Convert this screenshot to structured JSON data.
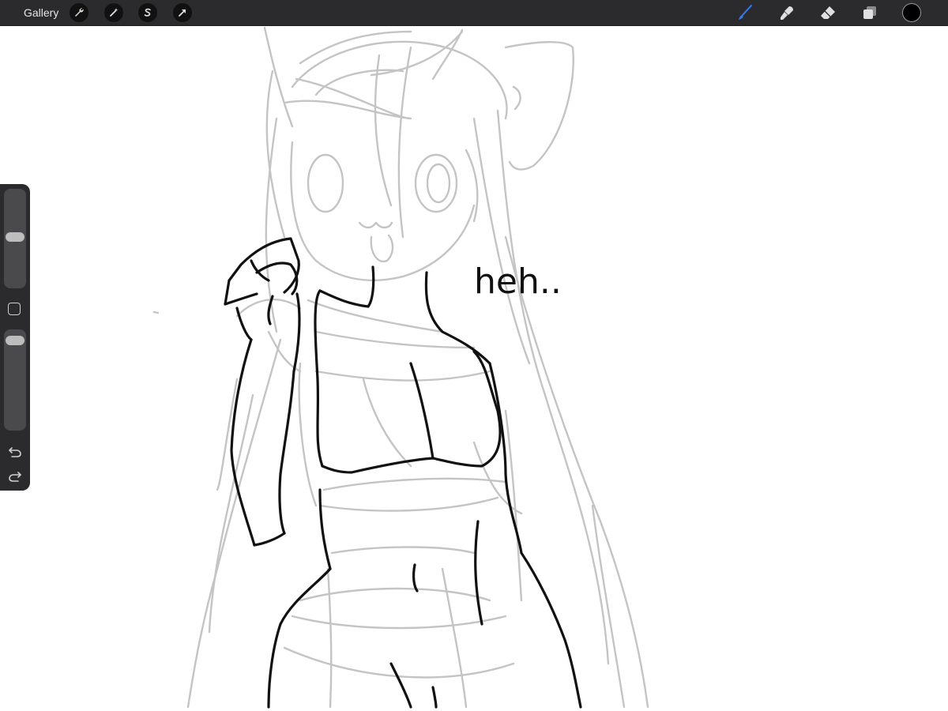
{
  "topbar": {
    "gallery_label": "Gallery",
    "left_tools": [
      {
        "icon": "wrench-icon",
        "name": "actions"
      },
      {
        "icon": "magic-wand-icon",
        "name": "adjustments"
      },
      {
        "icon": "selection-icon",
        "name": "selection"
      },
      {
        "icon": "arrow-transform-icon",
        "name": "transform"
      }
    ],
    "right_tools": [
      {
        "icon": "brush-icon",
        "name": "paint",
        "active": true
      },
      {
        "icon": "smudge-icon",
        "name": "smudge"
      },
      {
        "icon": "eraser-icon",
        "name": "erase"
      },
      {
        "icon": "layers-icon",
        "name": "layers"
      }
    ],
    "current_color": "#000000",
    "accent_color": "#3478f6"
  },
  "canvas": {
    "handwritten_text": "heh.."
  },
  "sidebar": {
    "brush_size_level": 0.52,
    "opacity_level": 0.95
  }
}
